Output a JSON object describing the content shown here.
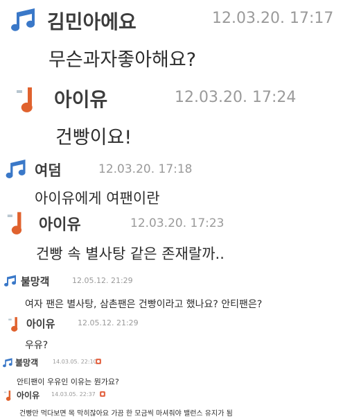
{
  "icons": {
    "blue_note": "music-note-blue-icon",
    "orange_note": "music-note-orange-icon",
    "blue_color": "#3a78c8",
    "orange_color": "#e0622e"
  },
  "comments": [
    {
      "author": "김민아에요",
      "date": "12.03.20. 17:17",
      "message": "무슨과자좋아해요?",
      "icon": "blue"
    },
    {
      "author": "아이유",
      "date": "12.03.20. 17:24",
      "message": "건빵이요!",
      "icon": "orange"
    },
    {
      "author": "여덤",
      "date": "12.03.20. 17:18",
      "message": "아이유에게 여팬이란",
      "icon": "blue"
    },
    {
      "author": "아이유",
      "date": "12.03.20. 17:23",
      "message": "건빵 속 별사탕 같은 존재랄까..",
      "icon": "orange"
    },
    {
      "author": "불망객",
      "date": "12.05.12. 21:29",
      "message": "여자 팬은 별사탕, 삼촌팬은 건빵이라고 했나요? 안티팬은?",
      "icon": "blue"
    },
    {
      "author": "아이유",
      "date": "12.05.12. 21:29",
      "message": "우유?",
      "icon": "orange"
    },
    {
      "author": "불망객",
      "date": "14.03.05. 22:10",
      "message": "안티팬이 우유인 이유는 뭔가요?",
      "icon": "blue",
      "new_badge": true
    },
    {
      "author": "아이유",
      "date": "14.03.05. 22:37",
      "message": "건빵만 먹다보면 목 막히잖아요 가끔 한 모금씩 마셔줘야 밸런스 유지가 됨",
      "icon": "orange",
      "new_badge": true
    }
  ]
}
